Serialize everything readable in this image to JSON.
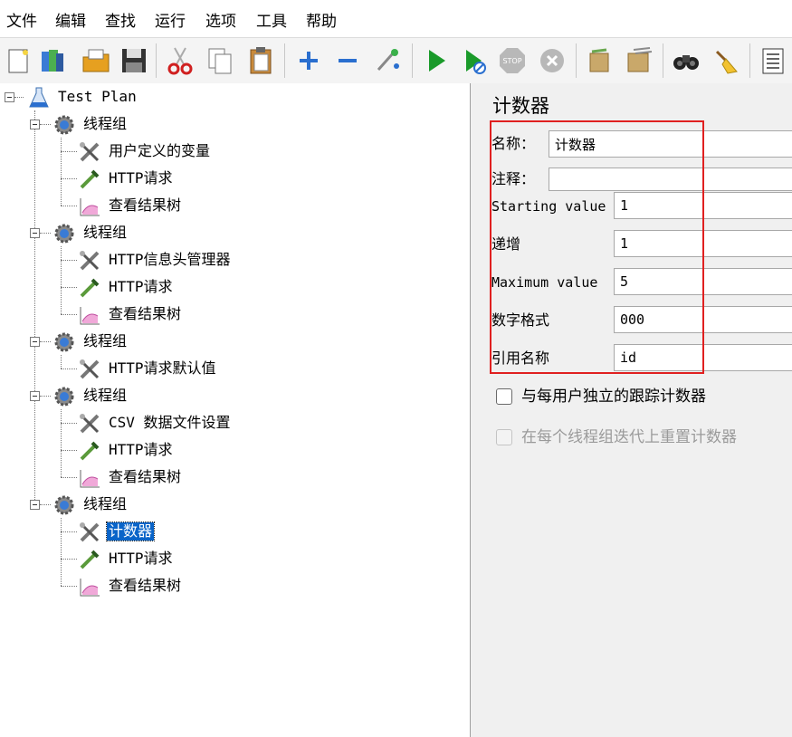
{
  "menu": [
    "文件",
    "编辑",
    "查找",
    "运行",
    "选项",
    "工具",
    "帮助"
  ],
  "toolbar": {
    "buttons": [
      "new-icon",
      "templates-icon",
      "open-icon",
      "save-icon",
      "cut-icon",
      "copy-icon",
      "paste-icon",
      "expand-icon",
      "collapse-icon",
      "toggle-icon",
      "start-icon",
      "start-no-pause-icon",
      "stop-icon",
      "shutdown-icon",
      "clear-icon",
      "clear-all-icon",
      "search-icon",
      "reset-search-icon",
      "function-helper-icon"
    ]
  },
  "tree": {
    "root": "Test Plan",
    "groups": [
      {
        "label": "线程组",
        "children": [
          "用户定义的变量",
          "HTTP请求",
          "查看结果树"
        ]
      },
      {
        "label": "线程组",
        "children": [
          "HTTP信息头管理器",
          "HTTP请求",
          "查看结果树"
        ]
      },
      {
        "label": "线程组",
        "children": [
          "HTTP请求默认值"
        ]
      },
      {
        "label": "线程组",
        "children": [
          "CSV 数据文件设置",
          "HTTP请求",
          "查看结果树"
        ]
      },
      {
        "label": "线程组",
        "children": [
          "计数器",
          "HTTP请求",
          "查看结果树"
        ]
      }
    ],
    "selected": "计数器"
  },
  "panel": {
    "title": "计数器",
    "fields": {
      "name": {
        "label": "名称：",
        "value": "计数器"
      },
      "comment": {
        "label": "注释：",
        "value": ""
      },
      "start": {
        "label": "Starting value",
        "value": "1"
      },
      "increment": {
        "label": "递增",
        "value": "1"
      },
      "max": {
        "label": "Maximum value",
        "value": "5"
      },
      "format": {
        "label": "数字格式",
        "value": "000"
      },
      "refname": {
        "label": "引用名称",
        "value": "id"
      }
    },
    "checkboxes": [
      {
        "label": "与每用户独立的跟踪计数器",
        "checked": false,
        "enabled": true
      },
      {
        "label": "在每个线程组迭代上重置计数器",
        "checked": false,
        "enabled": false
      }
    ]
  },
  "colors": {
    "selection": "#0a64c8",
    "highlight_box": "#e02020",
    "panel_bg": "#f0f0f0"
  }
}
